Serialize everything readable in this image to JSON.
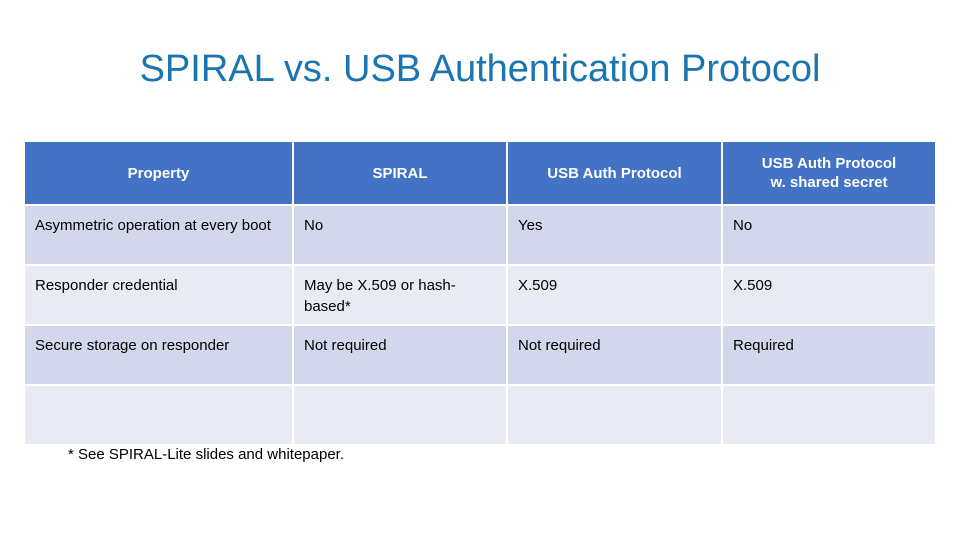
{
  "slide": {
    "title": "SPIRAL vs. USB Authentication Protocol",
    "title_color": "#1A75B0",
    "background_color": "#FFFFFF"
  },
  "table": {
    "header_background": "#4472C4",
    "header_text_color": "#FFFFFF",
    "band_dark": "#D2D7EB",
    "band_light": "#E8EAF4",
    "headers": [
      "Property",
      "SPIRAL",
      "USB Auth Protocol",
      "USB Auth Protocol\nw. shared secret"
    ],
    "header_4_line1": "USB Auth Protocol",
    "header_4_line2": "w. shared secret",
    "rows": [
      {
        "property": "Asymmetric operation at every boot",
        "spiral": "No",
        "usb_auth": "Yes",
        "usb_auth_shared": "No"
      },
      {
        "property": "Responder credential",
        "spiral": "May be X.509 or hash-based*",
        "usb_auth": "X.509",
        "usb_auth_shared": "X.509"
      },
      {
        "property": "Secure storage on responder",
        "spiral": "Not required",
        "usb_auth": "Not required",
        "usb_auth_shared": "Required"
      },
      {
        "property": "",
        "spiral": "",
        "usb_auth": "",
        "usb_auth_shared": ""
      }
    ]
  },
  "footnote": {
    "text": "* See SPIRAL-Lite slides and whitepaper."
  }
}
